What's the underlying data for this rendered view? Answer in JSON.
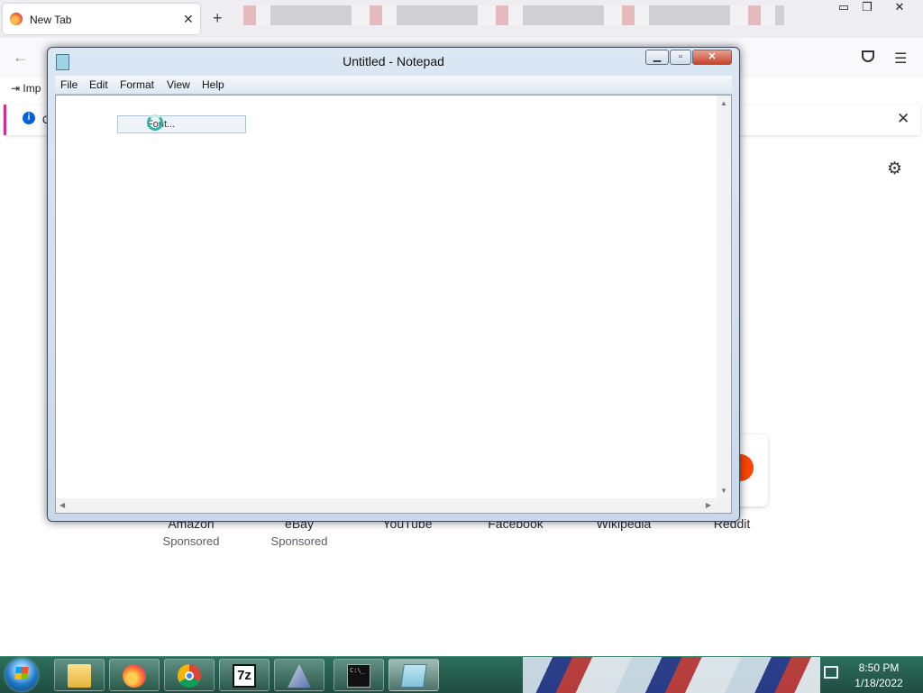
{
  "browser": {
    "tab_title": "New Tab",
    "tab_close": "✕",
    "new_tab": "+",
    "back": "←",
    "menu": "☰",
    "bookmark_label": "Imp",
    "notification_text": "O",
    "notification_close": "✕",
    "settings_glyph": "⚙",
    "window_minimize": "▭",
    "window_restore": "❐",
    "window_close": "✕",
    "top_sites": [
      {
        "label": "Amazon",
        "sub": "Sponsored"
      },
      {
        "label": "eBay",
        "sub": "Sponsored"
      },
      {
        "label": "YouTube",
        "sub": ""
      },
      {
        "label": "Facebook",
        "sub": ""
      },
      {
        "label": "Wikipedia",
        "sub": ""
      },
      {
        "label": "Reddit",
        "sub": ""
      }
    ]
  },
  "notepad": {
    "title": "Untitled - Notepad",
    "minimize": "▁",
    "maximize": "▫",
    "close": "✕",
    "menus": [
      "File",
      "Edit",
      "Format",
      "View",
      "Help"
    ],
    "dropdown_item": "Font..."
  },
  "taskbar": {
    "time": "8:50 PM",
    "date": "1/18/2022",
    "sevenzip_label": "7z",
    "cmd_label": "C:\\_"
  }
}
